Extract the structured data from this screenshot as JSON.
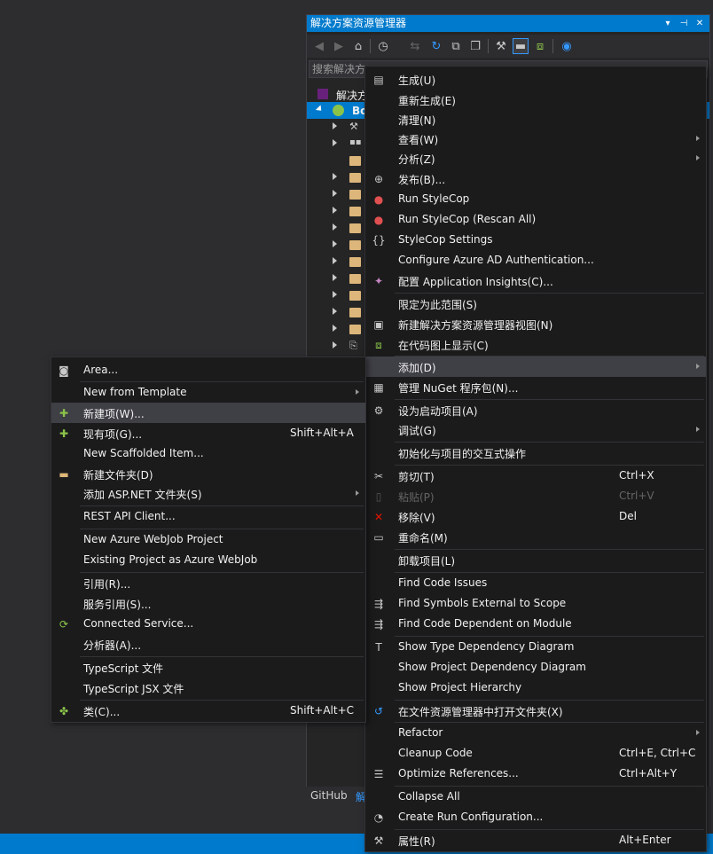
{
  "solution_explorer": {
    "title": "解决方案资源管理器",
    "title_buttons": [
      "▾",
      "⊣",
      "✕"
    ],
    "search_placeholder": "搜索解决方",
    "solution_label": "解决方",
    "project_label": "Bo",
    "bottom_tabs": [
      "GitHub",
      "解"
    ]
  },
  "context_menu": {
    "items": [
      {
        "label": "生成(U)",
        "icon": "build-icon"
      },
      {
        "label": "重新生成(E)"
      },
      {
        "label": "清理(N)"
      },
      {
        "label": "查看(W)",
        "submenu": true
      },
      {
        "label": "分析(Z)",
        "submenu": true
      },
      {
        "label": "发布(B)...",
        "icon": "publish-icon"
      },
      {
        "label": "Run StyleCop",
        "icon": "stylecop-icon"
      },
      {
        "label": "Run StyleCop (Rescan All)",
        "icon": "stylecop-icon"
      },
      {
        "label": "StyleCop Settings",
        "icon": "braces-icon"
      },
      {
        "label": "Configure Azure AD Authentication..."
      },
      {
        "label": "配置 Application Insights(C)...",
        "icon": "lightbulb-icon"
      },
      {
        "label": "限定为此范围(S)"
      },
      {
        "label": "新建解决方案资源管理器视图(N)",
        "icon": "new-view-icon"
      },
      {
        "label": "在代码图上显示(C)",
        "icon": "code-map-icon"
      },
      {
        "label": "添加(D)",
        "submenu": true,
        "highlighted": true
      },
      {
        "label": "管理 NuGet 程序包(N)...",
        "icon": "nuget-icon"
      },
      {
        "label": "设为启动项目(A)",
        "icon": "gear-icon"
      },
      {
        "label": "调试(G)",
        "submenu": true
      },
      {
        "label": "初始化与项目的交互式操作"
      },
      {
        "label": "剪切(T)",
        "shortcut": "Ctrl+X",
        "icon": "scissors-icon"
      },
      {
        "label": "粘贴(P)",
        "shortcut": "Ctrl+V",
        "icon": "paste-icon",
        "disabled": true
      },
      {
        "label": "移除(V)",
        "shortcut": "Del",
        "icon": "remove-icon"
      },
      {
        "label": "重命名(M)",
        "icon": "rename-icon"
      },
      {
        "label": "卸载项目(L)"
      },
      {
        "label": "Find Code Issues"
      },
      {
        "label": "Find Symbols External to Scope",
        "icon": "find-symbols-icon"
      },
      {
        "label": "Find Code Dependent on Module",
        "icon": "find-dependent-icon"
      },
      {
        "label": "Show Type Dependency Diagram",
        "icon": "diagram-icon"
      },
      {
        "label": "Show Project Dependency Diagram"
      },
      {
        "label": "Show Project Hierarchy"
      },
      {
        "label": "在文件资源管理器中打开文件夹(X)",
        "icon": "open-folder-icon"
      },
      {
        "label": "Refactor",
        "submenu": true
      },
      {
        "label": "Cleanup Code",
        "shortcut": "Ctrl+E, Ctrl+C"
      },
      {
        "label": "Optimize References...",
        "shortcut": "Ctrl+Alt+Y",
        "icon": "references-icon"
      },
      {
        "label": "Collapse All"
      },
      {
        "label": "Create Run Configuration...",
        "icon": "run-config-icon"
      },
      {
        "label": "属性(R)",
        "shortcut": "Alt+Enter",
        "icon": "wrench-icon"
      }
    ]
  },
  "add_submenu": {
    "items": [
      {
        "label": "Area...",
        "icon": "area-icon"
      },
      {
        "label": "New from Template",
        "submenu": true
      },
      {
        "label": "新建项(W)...",
        "icon": "new-item-icon",
        "highlighted": true
      },
      {
        "label": "现有项(G)...",
        "shortcut": "Shift+Alt+A",
        "icon": "existing-item-icon"
      },
      {
        "label": "New Scaffolded Item..."
      },
      {
        "label": "新建文件夹(D)",
        "icon": "new-folder-icon"
      },
      {
        "label": "添加 ASP.NET 文件夹(S)",
        "submenu": true
      },
      {
        "label": "REST API Client..."
      },
      {
        "label": "New Azure WebJob Project"
      },
      {
        "label": "Existing Project as Azure WebJob"
      },
      {
        "label": "引用(R)..."
      },
      {
        "label": "服务引用(S)..."
      },
      {
        "label": "Connected Service...",
        "icon": "connected-service-icon"
      },
      {
        "label": "分析器(A)..."
      },
      {
        "label": "TypeScript 文件"
      },
      {
        "label": "TypeScript JSX 文件"
      },
      {
        "label": "类(C)...",
        "shortcut": "Shift+Alt+C",
        "icon": "class-icon"
      }
    ]
  },
  "colors": {
    "accent": "#007acc",
    "menu_bg": "#1b1b1c",
    "highlight": "#3f3f46",
    "folder": "#dcb67a"
  }
}
